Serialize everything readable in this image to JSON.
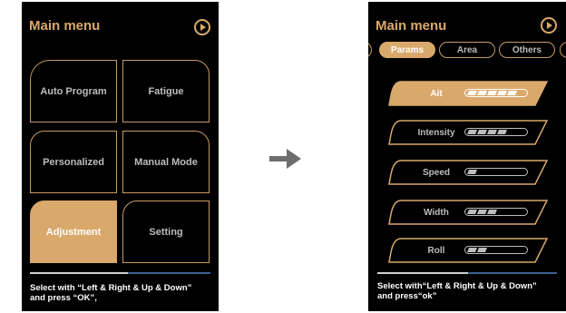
{
  "colors": {
    "accent": "#d9a96b",
    "screen_bg": "#000000",
    "text": "#bdbdbd",
    "arrow": "#6e6e6e"
  },
  "left_screen": {
    "title": "Main menu",
    "buttons": [
      {
        "label": "Auto Program",
        "active": false
      },
      {
        "label": "Fatigue",
        "active": false
      },
      {
        "label": "Personalized",
        "active": false
      },
      {
        "label": "Manual Mode",
        "active": false
      },
      {
        "label": "Adjustment",
        "active": true
      },
      {
        "label": "Setting",
        "active": false
      }
    ],
    "footer": {
      "line1": "Select with “Left & Right & Up & Down”",
      "line2": "and press “OK”,"
    }
  },
  "right_screen": {
    "title": "Main menu",
    "tabs": [
      {
        "label": "Params",
        "active": true
      },
      {
        "label": "Area",
        "active": false
      },
      {
        "label": "Others",
        "active": false
      }
    ],
    "params": [
      {
        "label": "Ait",
        "level": 5,
        "max": 5,
        "active": true
      },
      {
        "label": "Intensity",
        "level": 4,
        "max": 5,
        "active": false
      },
      {
        "label": "Speed",
        "level": 1,
        "max": 5,
        "active": false
      },
      {
        "label": "Width",
        "level": 3,
        "max": 5,
        "active": false
      },
      {
        "label": "Roll",
        "level": 2,
        "max": 5,
        "active": false
      }
    ],
    "footer": {
      "line1": "Select with“Left & Right & Up & Down”",
      "line2": "and press“ok”"
    }
  },
  "icons": {
    "play": "play-circle-icon",
    "arrow": "arrow-right-icon"
  }
}
